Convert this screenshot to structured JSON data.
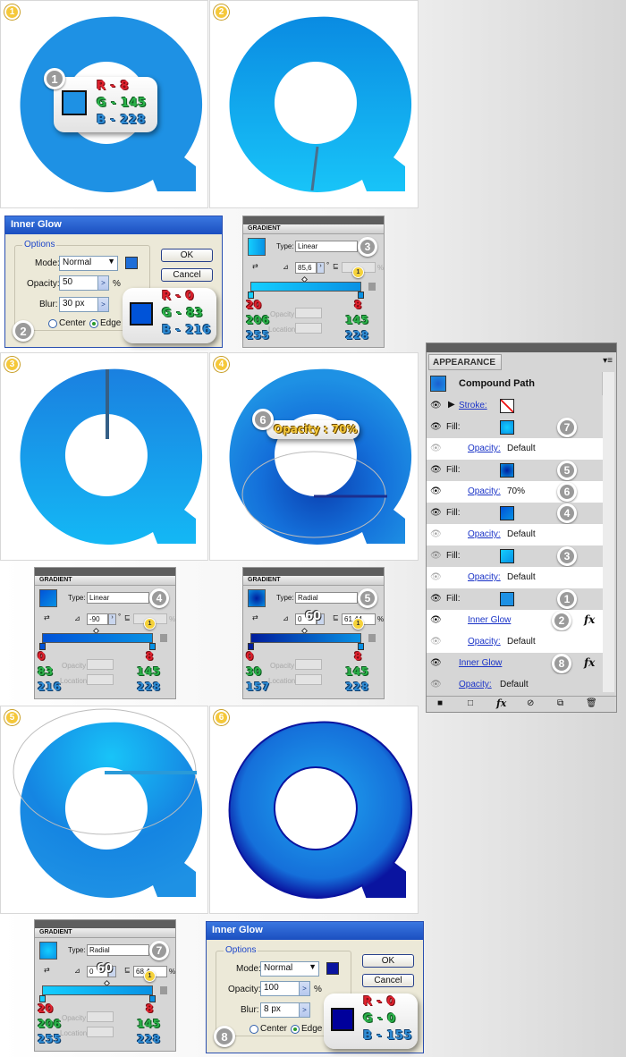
{
  "steps": {
    "s1": "1",
    "s2": "2",
    "s3": "3",
    "s4": "4",
    "s5": "5",
    "s6": "6"
  },
  "colors": {
    "bright_blue": "#1E91E4",
    "mid_blue": "#1E6ED8",
    "inner_dark": "#0A14A0"
  },
  "step1_rgb": {
    "badge": "1",
    "r": "R - 8",
    "g": "G - 145",
    "b": "B - 228"
  },
  "inner_glow_1": {
    "title": "Inner Glow",
    "options": "Options",
    "mode_label": "Mode:",
    "mode": "Normal",
    "opacity_label": "Opacity:",
    "opacity": "50",
    "opacity_unit": "%",
    "blur_label": "Blur:",
    "blur": "30 px",
    "center": "Center",
    "edge": "Edge",
    "ok": "OK",
    "cancel": "Cancel",
    "badge": "2",
    "r": "R - 0",
    "g": "G - 83",
    "b": "B - 216"
  },
  "gradient_3": {
    "title": "GRADIENT",
    "type_label": "Type:",
    "type": "Linear",
    "badge": "3",
    "angle": "85,6",
    "degree": "°",
    "percent": "%",
    "loc_badge": "1",
    "opacity_label": "Opacity",
    "location_label": "Location",
    "left": {
      "r": "20",
      "g": "206",
      "b": "255"
    },
    "right": {
      "r": "8",
      "g": "145",
      "b": "228"
    }
  },
  "gradient_4": {
    "title": "GRADIENT",
    "type_label": "Type:",
    "type": "Linear",
    "badge": "4",
    "angle": "-90",
    "degree": "°",
    "percent": "%",
    "loc_badge": "1",
    "opacity_label": "Opacity",
    "location_label": "Location",
    "left": {
      "r": "0",
      "g": "83",
      "b": "216"
    },
    "right": {
      "r": "8",
      "g": "145",
      "b": "228"
    }
  },
  "gradient_5": {
    "title": "GRADIENT",
    "type_label": "Type:",
    "type": "Radial",
    "badge": "5",
    "angle": "0",
    "ratio_hint": "60",
    "ratio": "61,44",
    "percent": "%",
    "loc_badge": "1",
    "opacity_label": "Opacity",
    "location_label": "Location",
    "left": {
      "r": "0",
      "g": "30",
      "b": "157"
    },
    "right": {
      "r": "8",
      "g": "145",
      "b": "228"
    }
  },
  "gradient_7": {
    "title": "GRADIENT",
    "type_label": "Type:",
    "type": "Radial",
    "badge": "7",
    "angle": "0",
    "ratio_hint": "60",
    "ratio": "68,4",
    "percent": "%",
    "loc_badge": "1",
    "opacity_label": "Opacity",
    "location_label": "Location",
    "left": {
      "r": "20",
      "g": "206",
      "b": "255"
    },
    "right": {
      "r": "8",
      "g": "145",
      "b": "228"
    }
  },
  "opacity_callout": {
    "badge": "6",
    "text": "Opacity : 70%"
  },
  "inner_glow_2": {
    "title": "Inner Glow",
    "options": "Options",
    "mode_label": "Mode:",
    "mode": "Normal",
    "opacity_label": "Opacity:",
    "opacity": "100",
    "opacity_unit": "%",
    "blur_label": "Blur:",
    "blur": "8 px",
    "center": "Center",
    "edge": "Edge",
    "ok": "OK",
    "cancel": "Cancel",
    "badge": "8",
    "r": "R - 0",
    "g": "G - 0",
    "b": "B - 155"
  },
  "appearance": {
    "title": "APPEARANCE",
    "object": "Compound Path",
    "stroke": "Stroke:",
    "fill": "Fill:",
    "opacity": "Opacity:",
    "default": "Default",
    "seventy": "70%",
    "inner_glow": "Inner Glow",
    "fx": "fx",
    "badges": {
      "b7": "7",
      "b5": "5",
      "b6": "6",
      "b4": "4",
      "b3": "3",
      "b1": "1",
      "b2": "2",
      "b8": "8"
    }
  }
}
